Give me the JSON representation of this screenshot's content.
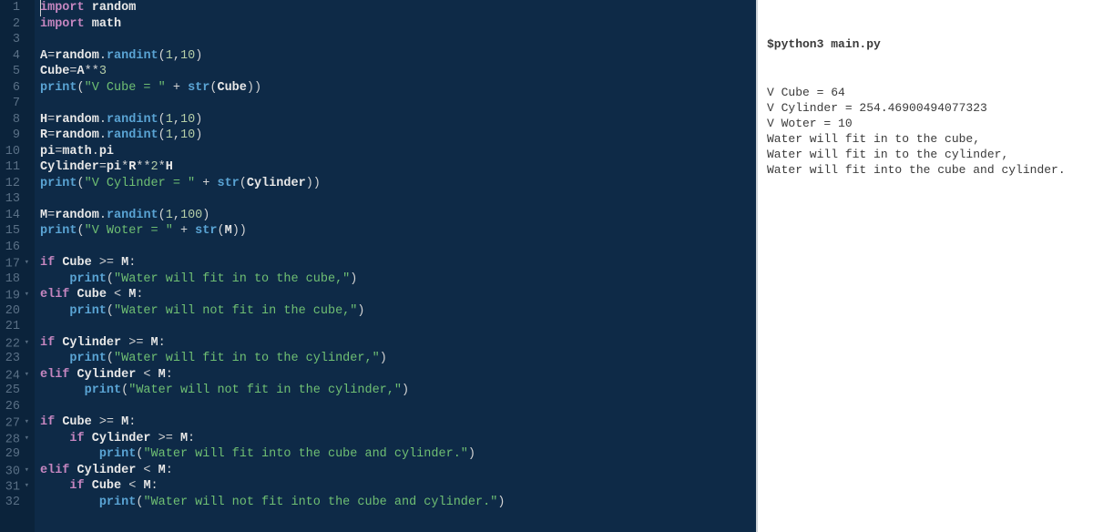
{
  "editor": {
    "line_count": 32,
    "fold_lines": [
      17,
      19,
      22,
      24,
      27,
      28,
      30,
      31
    ],
    "code_rows": [
      [
        [
          "kw",
          "import"
        ],
        [
          "op",
          " "
        ],
        [
          "mod",
          "random"
        ]
      ],
      [
        [
          "kw",
          "import"
        ],
        [
          "op",
          " "
        ],
        [
          "mod",
          "math"
        ]
      ],
      [],
      [
        [
          "var",
          "A"
        ],
        [
          "op",
          "="
        ],
        [
          "attr",
          "random"
        ],
        [
          "op",
          "."
        ],
        [
          "fn",
          "randint"
        ],
        [
          "op",
          "("
        ],
        [
          "num",
          "1"
        ],
        [
          "op",
          ","
        ],
        [
          "num",
          "10"
        ],
        [
          "op",
          ")"
        ]
      ],
      [
        [
          "var",
          "Cube"
        ],
        [
          "op",
          "="
        ],
        [
          "var",
          "A"
        ],
        [
          "op",
          "**"
        ],
        [
          "num",
          "3"
        ]
      ],
      [
        [
          "fn",
          "print"
        ],
        [
          "op",
          "("
        ],
        [
          "str",
          "\"V Cube = \""
        ],
        [
          "op",
          " + "
        ],
        [
          "fn",
          "str"
        ],
        [
          "op",
          "("
        ],
        [
          "var",
          "Cube"
        ],
        [
          "op",
          "))"
        ]
      ],
      [],
      [
        [
          "var",
          "H"
        ],
        [
          "op",
          "="
        ],
        [
          "attr",
          "random"
        ],
        [
          "op",
          "."
        ],
        [
          "fn",
          "randint"
        ],
        [
          "op",
          "("
        ],
        [
          "num",
          "1"
        ],
        [
          "op",
          ","
        ],
        [
          "num",
          "10"
        ],
        [
          "op",
          ")"
        ]
      ],
      [
        [
          "var",
          "R"
        ],
        [
          "op",
          "="
        ],
        [
          "attr",
          "random"
        ],
        [
          "op",
          "."
        ],
        [
          "fn",
          "randint"
        ],
        [
          "op",
          "("
        ],
        [
          "num",
          "1"
        ],
        [
          "op",
          ","
        ],
        [
          "num",
          "10"
        ],
        [
          "op",
          ")"
        ]
      ],
      [
        [
          "var",
          "pi"
        ],
        [
          "op",
          "="
        ],
        [
          "attr",
          "math"
        ],
        [
          "op",
          "."
        ],
        [
          "attr",
          "pi"
        ]
      ],
      [
        [
          "var",
          "Cylinder"
        ],
        [
          "op",
          "="
        ],
        [
          "var",
          "pi"
        ],
        [
          "op",
          "*"
        ],
        [
          "var",
          "R"
        ],
        [
          "op",
          "**"
        ],
        [
          "num",
          "2"
        ],
        [
          "op",
          "*"
        ],
        [
          "var",
          "H"
        ]
      ],
      [
        [
          "fn",
          "print"
        ],
        [
          "op",
          "("
        ],
        [
          "str",
          "\"V Cylinder = \""
        ],
        [
          "op",
          " + "
        ],
        [
          "fn",
          "str"
        ],
        [
          "op",
          "("
        ],
        [
          "var",
          "Cylinder"
        ],
        [
          "op",
          "))"
        ]
      ],
      [],
      [
        [
          "var",
          "M"
        ],
        [
          "op",
          "="
        ],
        [
          "attr",
          "random"
        ],
        [
          "op",
          "."
        ],
        [
          "fn",
          "randint"
        ],
        [
          "op",
          "("
        ],
        [
          "num",
          "1"
        ],
        [
          "op",
          ","
        ],
        [
          "num",
          "100"
        ],
        [
          "op",
          ")"
        ]
      ],
      [
        [
          "fn",
          "print"
        ],
        [
          "op",
          "("
        ],
        [
          "str",
          "\"V Woter = \""
        ],
        [
          "op",
          " + "
        ],
        [
          "fn",
          "str"
        ],
        [
          "op",
          "("
        ],
        [
          "var",
          "M"
        ],
        [
          "op",
          "))"
        ]
      ],
      [],
      [
        [
          "kw",
          "if"
        ],
        [
          "op",
          " "
        ],
        [
          "var",
          "Cube"
        ],
        [
          "op",
          " >= "
        ],
        [
          "var",
          "M"
        ],
        [
          "op",
          ":"
        ]
      ],
      [
        [
          "op",
          "    "
        ],
        [
          "fn",
          "print"
        ],
        [
          "op",
          "("
        ],
        [
          "str",
          "\"Water will fit in to the cube,\""
        ],
        [
          "op",
          ")"
        ]
      ],
      [
        [
          "kw",
          "elif"
        ],
        [
          "op",
          " "
        ],
        [
          "var",
          "Cube"
        ],
        [
          "op",
          " < "
        ],
        [
          "var",
          "M"
        ],
        [
          "op",
          ":"
        ]
      ],
      [
        [
          "op",
          "    "
        ],
        [
          "fn",
          "print"
        ],
        [
          "op",
          "("
        ],
        [
          "str",
          "\"Water will not fit in the cube,\""
        ],
        [
          "op",
          ")"
        ]
      ],
      [],
      [
        [
          "kw",
          "if"
        ],
        [
          "op",
          " "
        ],
        [
          "var",
          "Cylinder"
        ],
        [
          "op",
          " >= "
        ],
        [
          "var",
          "M"
        ],
        [
          "op",
          ":"
        ]
      ],
      [
        [
          "op",
          "    "
        ],
        [
          "fn",
          "print"
        ],
        [
          "op",
          "("
        ],
        [
          "str",
          "\"Water will fit in to the cylinder,\""
        ],
        [
          "op",
          ")"
        ]
      ],
      [
        [
          "kw",
          "elif"
        ],
        [
          "op",
          " "
        ],
        [
          "var",
          "Cylinder"
        ],
        [
          "op",
          " < "
        ],
        [
          "var",
          "M"
        ],
        [
          "op",
          ":"
        ]
      ],
      [
        [
          "op",
          "      "
        ],
        [
          "fn",
          "print"
        ],
        [
          "op",
          "("
        ],
        [
          "str",
          "\"Water will not fit in the cylinder,\""
        ],
        [
          "op",
          ")"
        ]
      ],
      [],
      [
        [
          "kw",
          "if"
        ],
        [
          "op",
          " "
        ],
        [
          "var",
          "Cube"
        ],
        [
          "op",
          " >= "
        ],
        [
          "var",
          "M"
        ],
        [
          "op",
          ":"
        ]
      ],
      [
        [
          "op",
          "    "
        ],
        [
          "kw",
          "if"
        ],
        [
          "op",
          " "
        ],
        [
          "var",
          "Cylinder"
        ],
        [
          "op",
          " >= "
        ],
        [
          "var",
          "M"
        ],
        [
          "op",
          ":"
        ]
      ],
      [
        [
          "op",
          "        "
        ],
        [
          "fn",
          "print"
        ],
        [
          "op",
          "("
        ],
        [
          "str",
          "\"Water will fit into the cube and cylinder.\""
        ],
        [
          "op",
          ")"
        ]
      ],
      [
        [
          "kw",
          "elif"
        ],
        [
          "op",
          " "
        ],
        [
          "var",
          "Cylinder"
        ],
        [
          "op",
          " < "
        ],
        [
          "var",
          "M"
        ],
        [
          "op",
          ":"
        ]
      ],
      [
        [
          "op",
          "    "
        ],
        [
          "kw",
          "if"
        ],
        [
          "op",
          " "
        ],
        [
          "var",
          "Cube"
        ],
        [
          "op",
          " < "
        ],
        [
          "var",
          "M"
        ],
        [
          "op",
          ":"
        ]
      ],
      [
        [
          "op",
          "        "
        ],
        [
          "fn",
          "print"
        ],
        [
          "op",
          "("
        ],
        [
          "str",
          "\"Water will not fit into the cube and cylinder.\""
        ],
        [
          "op",
          ")"
        ]
      ]
    ]
  },
  "output": {
    "command": "$python3 main.py",
    "lines": [
      "V Cube = 64",
      "V Cylinder = 254.46900494077323",
      "V Woter = 10",
      "Water will fit in to the cube,",
      "Water will fit in to the cylinder,",
      "Water will fit into the cube and cylinder."
    ]
  }
}
